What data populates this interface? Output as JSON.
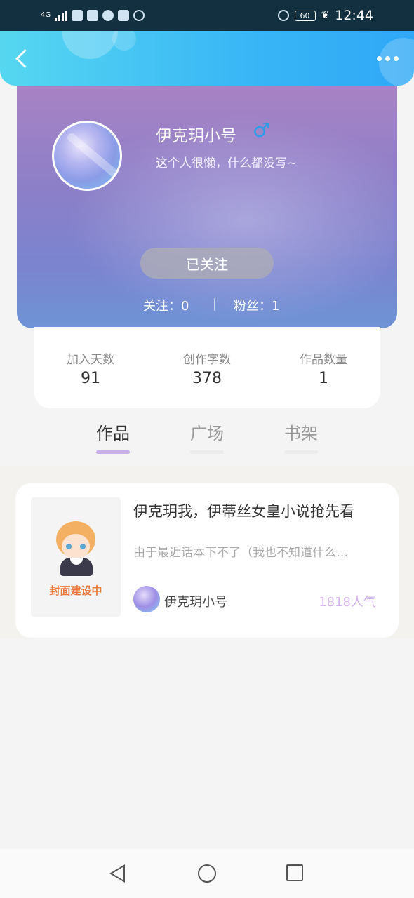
{
  "status_bar": {
    "network": "4G",
    "battery": "60",
    "time": "12:44"
  },
  "header": {
    "back_icon": "back-chevron-icon",
    "more_icon": "more-dots-icon"
  },
  "profile": {
    "username": "伊克玥小号",
    "gender_symbol": "♂",
    "bio": "这个人很懒，什么都没写~",
    "follow_button_label": "已关注",
    "following_text": "关注：0",
    "fans_text": "粉丝：1"
  },
  "stats": [
    {
      "label": "加入天数",
      "value": "91"
    },
    {
      "label": "创作字数",
      "value": "378"
    },
    {
      "label": "作品数量",
      "value": "1"
    }
  ],
  "tabs": [
    {
      "label": "作品",
      "active": true
    },
    {
      "label": "广场",
      "active": false
    },
    {
      "label": "书架",
      "active": false
    }
  ],
  "works": [
    {
      "cover_text": "封面建设中",
      "title": "伊克玥我，伊蒂丝女皇小说抢先看",
      "description": "由于最近话本下不了（我也不知道什么…",
      "author": "伊克玥小号",
      "popularity": "1818人气"
    }
  ],
  "colors": {
    "header_accent": "#38b6f6",
    "tab_active_underline": "#c6aee6",
    "popularity": "#d4b4ec",
    "gender_icon": "#2e9ce8"
  }
}
